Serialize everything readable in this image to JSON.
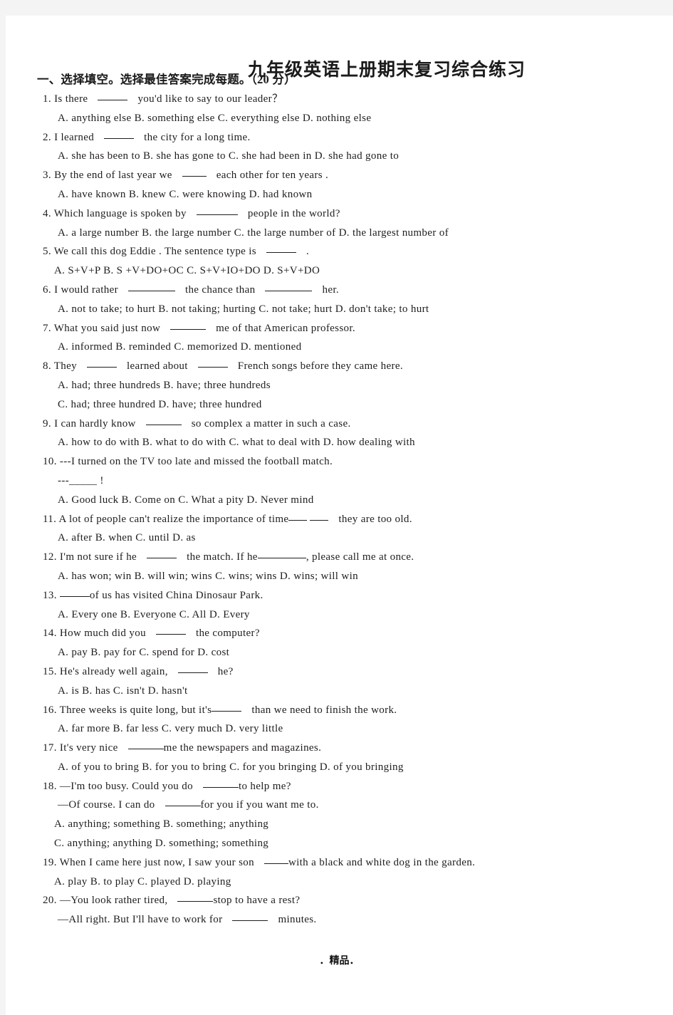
{
  "document": {
    "title": "九年级英语上册期末复习综合练习",
    "section_heading": "一、选择填空。选择最佳答案完成每题。（20 分）",
    "footer": "．精品．"
  },
  "questions": [
    {
      "number": "1.",
      "stem_before": "Is there",
      "blank": "______",
      "stem_after": "you'd like to say to our leader？",
      "options_lines": [
        "A. anything else        B. something else        C. everything else        D. nothing else"
      ]
    },
    {
      "number": "2.",
      "stem_before": "I learned",
      "blank": "______",
      "stem_after": "the city for a long time.",
      "options_lines": [
        "A. she has been to    B. she has gone to    C. she had been in    D. she had gone to"
      ]
    },
    {
      "number": "3.",
      "stem_before": "By the end of last year we",
      "blank": "_____",
      "stem_after": "each other for ten years .",
      "options_lines": [
        "A. have known    B. knew    C. were knowing    D. had known"
      ]
    },
    {
      "number": "4.",
      "stem_before": "Which language is spoken by",
      "blank": "_________",
      "stem_after": "people in the world?",
      "options_lines": [
        "A. a large number     B. the large number C. the large number of      D. the largest number of"
      ]
    },
    {
      "number": "5.",
      "stem_before": "We call this dog Eddie . The sentence type is",
      "blank": "______",
      "stem_after": ".",
      "options_lines": [
        "A. S+V+P          B. S +V+DO+OC          C. S+V+IO+DO          D. S+V+DO"
      ]
    },
    {
      "number": "6.",
      "stem_before": "I would rather",
      "blank": "_________",
      "stem_mid": "the chance than",
      "blank2": "_________",
      "stem_after": "her.",
      "options_lines": [
        "A. not to take; to hurt   B. not taking; hurting   C. not take; hurt   D. don't    take; to hurt"
      ]
    },
    {
      "number": "7.",
      "stem_before": "What you said just now",
      "blank": "_______",
      "stem_after": "me of that American professor.",
      "options_lines": [
        "A. informed         B. reminded         C. memorized         D. mentioned"
      ]
    },
    {
      "number": "8.",
      "stem_before": "They",
      "blank": "______",
      "stem_mid": "learned about",
      "blank2": "______",
      "stem_after": "French songs before they came here.",
      "options_lines": [
        "A. had; three hundreds                    B. have; three hundreds",
        "C. had; three hundred                     D. have; three hundred"
      ]
    },
    {
      "number": "9.",
      "stem_before": "I can hardly know",
      "blank": "_______",
      "stem_after": "so complex a matter in such a case.",
      "options_lines": [
        "A. how to do with      B. what to do with      C. what to deal with        D. how dealing with"
      ]
    },
    {
      "number": "10.",
      "stem_before": "---I turned on the TV too late and missed the football match.",
      "dialog_line": "---_____ !",
      "options_lines": [
        "A. Good luck          B. Come on          C. What a pity            D. Never mind"
      ]
    },
    {
      "number": "11.",
      "stem_before": "A lot of people can't realize the importance of time",
      "blank": "___ __",
      "stem_after": "they are too old.",
      "options_lines": [
        "A. after          B. when                 C. until                  D. as"
      ]
    },
    {
      "number": "12.",
      "stem_before": "I'm not sure if he",
      "blank": "_____",
      "stem_mid": "the match. If he",
      "blank2": "___ _____",
      "stem_after": ", please call me at once.",
      "options_lines": [
        "A. has won; win         B. will win; wins      C. wins; wins               D. wins; will win"
      ]
    },
    {
      "number": "13.",
      "stem_before": "",
      "blank": "_____",
      "stem_after": "of us has visited China Dinosaur Park.",
      "options_lines": [
        "A. Every one           B. Everyone               C. All              D. Every"
      ]
    },
    {
      "number": "14.",
      "stem_before": "How much did you",
      "blank": "_____",
      "stem_after": "the computer?",
      "options_lines": [
        "A. pay                 B. pay for                C. spend for      D. cost"
      ]
    },
    {
      "number": "15.",
      "stem_before": "He's already well again,",
      "blank": "_____",
      "stem_after": "he?",
      "options_lines": [
        "A. is                  B. has                    C. isn't            D. hasn't"
      ]
    },
    {
      "number": "16.",
      "stem_before": "Three weeks is quite long, but it's",
      "blank": "_____",
      "stem_after": "than we need to finish the work.",
      "options_lines": [
        "A. far more            B. far less            C. very much            D. very little"
      ]
    },
    {
      "number": "17.",
      "stem_before": "It's very nice",
      "blank": "_______",
      "stem_after": "me the newspapers and magazines.",
      "options_lines": [
        "A. of you to bring     B. for you to bring     C. for you bringing   D. of you bringing"
      ]
    },
    {
      "number": "18.",
      "stem_before": "—I'm too busy. Could you do",
      "blank": "_______",
      "stem_after": "to help me?",
      "dialog_line2_before": "—Of course. I can do",
      "dialog_line2_blank": "_______",
      "dialog_line2_after": "for you if you want me to.",
      "options_lines": [
        "A. anything; something            B. something; anything",
        "C. anything; anything             D. something; something"
      ]
    },
    {
      "number": "19.",
      "stem_before": "When I came here just now, I saw your son",
      "blank": "____",
      "stem_after": "with a black and white dog in the garden.",
      "options_lines": [
        "A. play       B. to play      C. played      D. playing"
      ]
    },
    {
      "number": "20.",
      "stem_before": "—You look rather tired,",
      "blank": "_______",
      "stem_after": "stop to have a rest?",
      "dialog_line2_before": "—All right. But I'll have to work for",
      "dialog_line2_blank": "_______",
      "dialog_line2_after": "minutes.",
      "options_lines": []
    }
  ]
}
